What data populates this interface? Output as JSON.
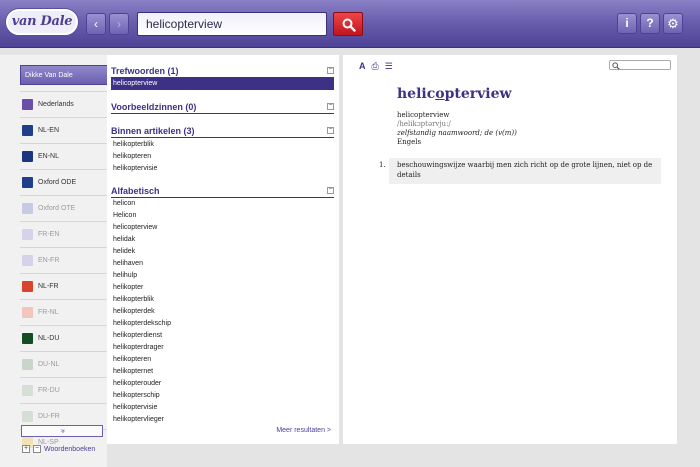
{
  "header": {
    "logo": "van Dale",
    "back_glyph": "‹",
    "forward_glyph": "›",
    "search_value": "helicopterview",
    "icons": {
      "search": "search-icon",
      "info": "info-icon",
      "help": "help-icon",
      "settings": "gear-icon"
    },
    "info_glyph": "i",
    "help_glyph": "?",
    "gear_glyph": "⚙"
  },
  "sidebar": {
    "items": [
      {
        "label": "Dikke Van Dale",
        "color": "#6b5fae",
        "active": true,
        "faded": false
      },
      {
        "label": "Nederlands",
        "color": "#6a4fa8",
        "active": false,
        "faded": false
      },
      {
        "label": "NL-EN",
        "color": "#1f3f8a",
        "active": false,
        "faded": false
      },
      {
        "label": "EN-NL",
        "color": "#1a3580",
        "active": false,
        "faded": false
      },
      {
        "label": "Oxford ODE",
        "color": "#1f3f8a",
        "active": false,
        "faded": false
      },
      {
        "label": "Oxford OTE",
        "color": "#c6cbe3",
        "active": false,
        "faded": true
      },
      {
        "label": "FR-EN",
        "color": "#d6d2ea",
        "active": false,
        "faded": true
      },
      {
        "label": "EN-FR",
        "color": "#d6d2ea",
        "active": false,
        "faded": true
      },
      {
        "label": "NL-FR",
        "color": "#d8442e",
        "active": false,
        "faded": false
      },
      {
        "label": "FR-NL",
        "color": "#f2c6bd",
        "active": false,
        "faded": true
      },
      {
        "label": "NL-DU",
        "color": "#124d24",
        "active": false,
        "faded": false
      },
      {
        "label": "DU-NL",
        "color": "#c8d6c9",
        "active": false,
        "faded": true
      },
      {
        "label": "FR-DU",
        "color": "#d5dfd6",
        "active": false,
        "faded": true
      },
      {
        "label": "DU-FR",
        "color": "#d5dfd6",
        "active": false,
        "faded": true
      },
      {
        "label": "NL-SP",
        "color": "#f0e2b5",
        "active": false,
        "faded": true
      }
    ],
    "expand_glyph": "»",
    "plus": "+",
    "minus": "−",
    "woordenboeken": "Woordenboeken"
  },
  "results": {
    "trefwoorden": {
      "title": "Trefwoorden (1)",
      "items": [
        "helicopterview"
      ]
    },
    "voorbeeldzinnen": {
      "title": "Voorbeeldzinnen (0)"
    },
    "binnen": {
      "title": "Binnen artikelen (3)",
      "items": [
        "helikopterblik",
        "helikopteren",
        "helikoptervisie"
      ]
    },
    "alfabetisch": {
      "title": "Alfabetisch",
      "items": [
        "helicon",
        "Helicon",
        "helicopterview",
        "helidak",
        "helidek",
        "helihaven",
        "helihulp",
        "helikopter",
        "helikopterblik",
        "helikopterdek",
        "helikopterdekschip",
        "helikopterdienst",
        "helikopterdrager",
        "helikopteren",
        "helikopternet",
        "helikopterouder",
        "helikopterschip",
        "helikoptervisie",
        "helikoptervlieger"
      ]
    },
    "collapse_glyph": "−",
    "meer": "Meer resultaten >"
  },
  "entry": {
    "tools": {
      "font": "A",
      "print": "⎙",
      "list": "☰"
    },
    "headword_pre": "helic",
    "headword_under": "o",
    "headword_post": "pterview",
    "form": "helicopterview",
    "pronunciation": "/helikɔptərvju:/",
    "grammar": "zelfstandig naamwoord; de (v(m))",
    "language": "Engels",
    "def_number": "1.",
    "definition": "beschouwingswijze waarbij men zich richt op de grote lijnen, niet op de details"
  }
}
